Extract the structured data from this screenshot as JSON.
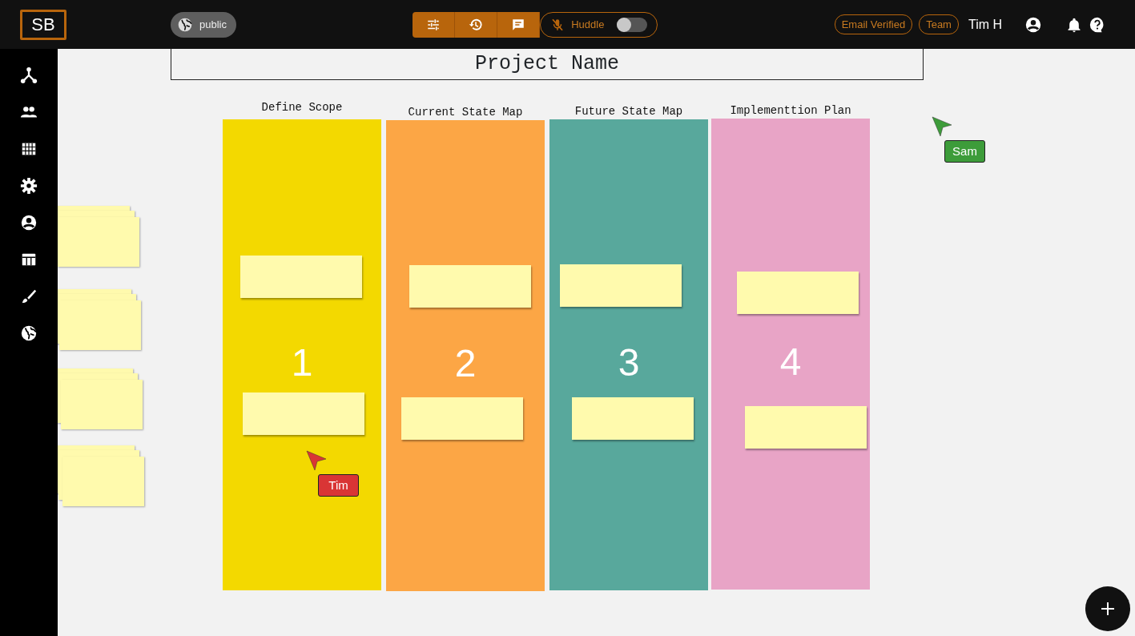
{
  "logo": "SB",
  "visibility": "public",
  "huddle": {
    "label": "Huddle",
    "on": false
  },
  "badges": [
    "Email Verified",
    "Team"
  ],
  "user": "Tim H",
  "board": {
    "title": "Project Name",
    "columns": [
      {
        "title": "Define Scope",
        "number": "1",
        "color": "#f3d900"
      },
      {
        "title": "Current State Map",
        "number": "2",
        "color": "#fca645"
      },
      {
        "title": "Future State Map",
        "number": "3",
        "color": "#58a89c"
      },
      {
        "title": "Implementtion Plan",
        "number": "4",
        "color": "#e8a4c6"
      }
    ]
  },
  "cursors": [
    {
      "name": "Sam",
      "color": "#3d9c3a"
    },
    {
      "name": "Tim",
      "color": "#d93535"
    }
  ]
}
